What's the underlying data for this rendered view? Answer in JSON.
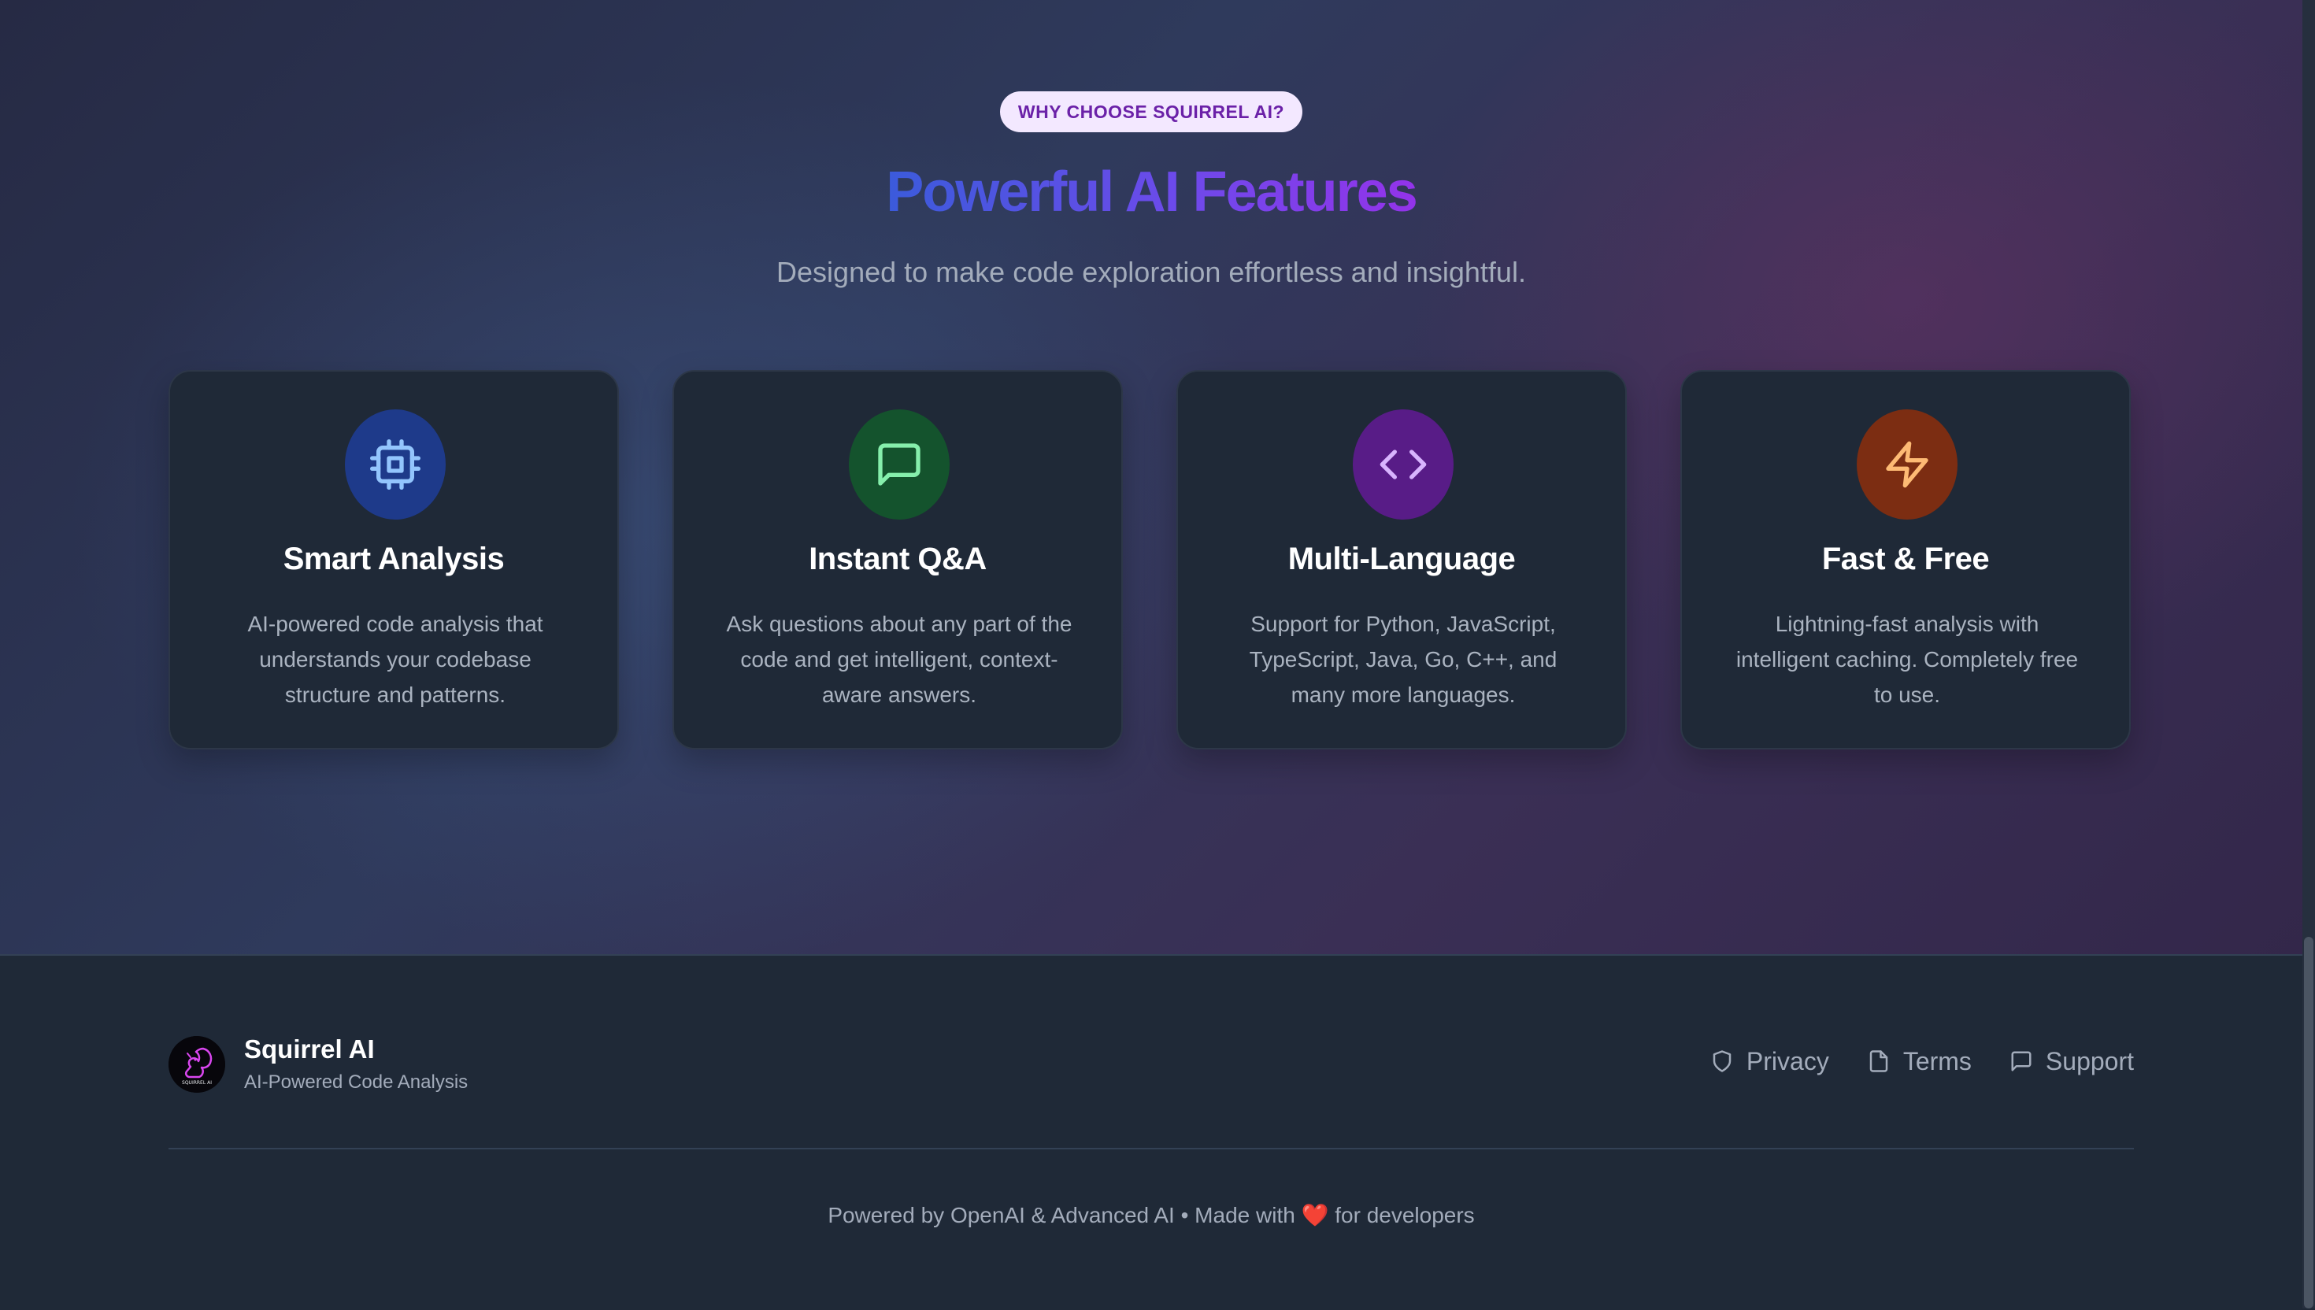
{
  "features_section": {
    "eyebrow": "WHY CHOOSE SQUIRREL AI?",
    "heading": "Powerful AI Features",
    "subtitle": "Designed to make code exploration effortless and insightful.",
    "cards": [
      {
        "icon": "cpu-icon",
        "icon_bg": "#1e3a8a",
        "icon_color": "#93c5fd",
        "title": "Smart Analysis",
        "description": "AI-powered code analysis that understands your codebase structure and patterns."
      },
      {
        "icon": "message-square-icon",
        "icon_bg": "#14532d",
        "icon_color": "#86efac",
        "title": "Instant Q&A",
        "description": "Ask questions about any part of the code and get intelligent, context-aware answers."
      },
      {
        "icon": "code-icon",
        "icon_bg": "#581c87",
        "icon_color": "#d8b4fe",
        "title": "Multi-Language",
        "description": "Support for Python, JavaScript, TypeScript, Java, Go, C++, and many more languages."
      },
      {
        "icon": "zap-icon",
        "icon_bg": "#7c2d12",
        "icon_color": "#fdba74",
        "title": "Fast & Free",
        "description": "Lightning-fast analysis with intelligent caching. Completely free to use."
      }
    ]
  },
  "footer": {
    "brand_logo_text": "SQUIRREL AI",
    "brand_name": "Squirrel AI",
    "brand_tagline": "AI-Powered Code Analysis",
    "links": [
      {
        "label": "Privacy",
        "icon": "shield-icon"
      },
      {
        "label": "Terms",
        "icon": "file-icon"
      },
      {
        "label": "Support",
        "icon": "message-square-icon"
      }
    ],
    "credit_prefix": "Powered by OpenAI & Advanced AI • Made with",
    "credit_heart": "❤️",
    "credit_suffix": "for developers"
  },
  "colors": {
    "accent_blue": "#3b5bdb",
    "accent_purple": "#9333ea",
    "card_bg": "#1f2937",
    "footer_bg": "#1f2937"
  }
}
